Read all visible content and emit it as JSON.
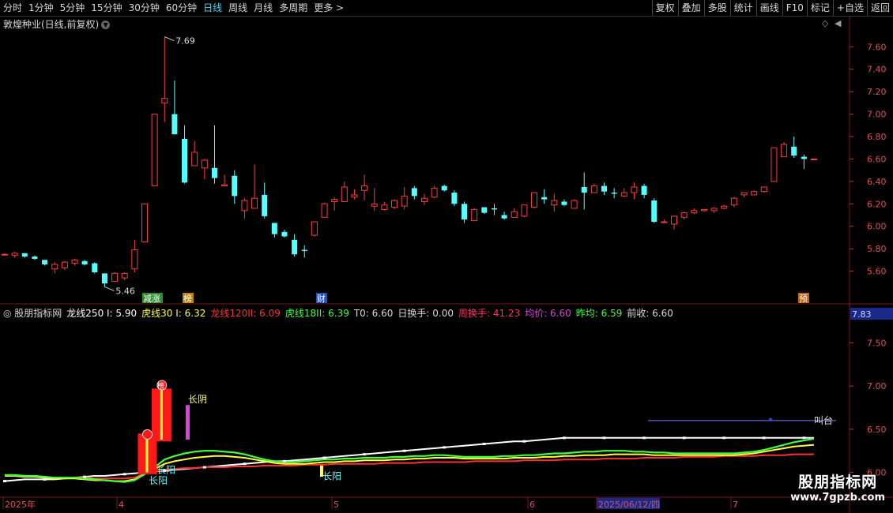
{
  "toolbar": {
    "periods": [
      "分时",
      "1分钟",
      "5分钟",
      "15分钟",
      "30分钟",
      "60分钟",
      "日线",
      "周线",
      "月线",
      "多周期",
      "更多 >"
    ],
    "active_period": "日线",
    "actions": [
      "复权",
      "叠加",
      "多股",
      "统计",
      "画线",
      "F10",
      "标记",
      "+自选",
      "返回"
    ]
  },
  "main_chart": {
    "title": "敦煌种业(日线,前复权)",
    "price_axis": [
      "7.60",
      "7.40",
      "7.20",
      "7.00",
      "6.80",
      "6.60",
      "6.40",
      "6.20",
      "6.00",
      "5.80",
      "5.60"
    ],
    "high_label": "7.69",
    "low_label": "5.46",
    "markers": [
      "减涨",
      "榜",
      "财",
      "预"
    ]
  },
  "indicator": {
    "name": "股朋指标网",
    "fields": [
      {
        "label": "龙线250 I",
        "value": "5.90",
        "color": "#ffffff"
      },
      {
        "label": "虎线30 I",
        "value": "6.32",
        "color": "#ffff40"
      },
      {
        "label": "龙线120II",
        "value": "6.09",
        "color": "#ff3030"
      },
      {
        "label": "虎线18II",
        "value": "6.39",
        "color": "#40ff40"
      },
      {
        "label": "T0",
        "value": "6.60",
        "color": "#d8d8d8"
      },
      {
        "label": "日换手",
        "value": "0.00",
        "color": "#d8d8d8"
      },
      {
        "label": "周换手",
        "value": "41.23",
        "color": "#ff3060"
      },
      {
        "label": "均价",
        "value": "6.60",
        "color": "#e040e0"
      },
      {
        "label": "昨均",
        "value": "6.59",
        "color": "#40ff40"
      },
      {
        "label": "前收",
        "value": "6.60",
        "color": "#d8d8d8"
      }
    ],
    "axis": [
      "7.50",
      "7.00",
      "6.50",
      "6.00"
    ],
    "axis_top": "7.83",
    "labels": [
      "榜",
      "长阴",
      "长阳",
      "长阳",
      "长阳",
      "叫台"
    ],
    "long_yin_label": "长阴",
    "long_yang_label": "长阳",
    "bang_label": "榜",
    "right_label": "叫台"
  },
  "date_axis": [
    "2025年",
    "4",
    "5",
    "6",
    "2025/06/12/四",
    "7"
  ],
  "watermark": {
    "line1": "股朋指标网",
    "line2": "www.7gpzb.com"
  },
  "chart_data": {
    "type": "candlestick",
    "title": "敦煌种业(日线,前复权)",
    "ylim": [
      5.4,
      7.75
    ],
    "candles": [
      [
        5.75,
        5.76,
        5.74,
        5.75
      ],
      [
        5.74,
        5.77,
        5.72,
        5.76
      ],
      [
        5.76,
        5.76,
        5.72,
        5.73
      ],
      [
        5.73,
        5.74,
        5.7,
        5.71
      ],
      [
        5.7,
        5.7,
        5.65,
        5.66
      ],
      [
        5.62,
        5.68,
        5.58,
        5.66
      ],
      [
        5.63,
        5.69,
        5.61,
        5.68
      ],
      [
        5.67,
        5.71,
        5.65,
        5.7
      ],
      [
        5.69,
        5.7,
        5.65,
        5.66
      ],
      [
        5.67,
        5.68,
        5.58,
        5.59
      ],
      [
        5.58,
        5.58,
        5.46,
        5.49
      ],
      [
        5.51,
        5.59,
        5.51,
        5.58
      ],
      [
        5.54,
        5.59,
        5.52,
        5.58
      ],
      [
        5.62,
        5.88,
        5.59,
        5.79
      ],
      [
        5.86,
        6.11,
        5.86,
        6.2
      ],
      [
        6.36,
        7.0,
        6.36,
        7.0
      ],
      [
        7.1,
        7.69,
        6.93,
        7.14
      ],
      [
        7.0,
        7.3,
        6.83,
        6.82
      ],
      [
        6.78,
        6.9,
        6.38,
        6.39
      ],
      [
        6.54,
        6.76,
        6.54,
        6.66
      ],
      [
        6.52,
        6.6,
        6.42,
        6.59
      ],
      [
        6.52,
        6.9,
        6.38,
        6.43
      ],
      [
        6.36,
        6.46,
        6.36,
        6.37
      ],
      [
        6.45,
        6.5,
        6.2,
        6.27
      ],
      [
        6.14,
        6.25,
        6.07,
        6.23
      ],
      [
        6.16,
        6.55,
        6.16,
        6.25
      ],
      [
        6.28,
        6.39,
        6.07,
        6.09
      ],
      [
        6.03,
        6.03,
        5.9,
        5.93
      ],
      [
        5.95,
        5.97,
        5.9,
        5.91
      ],
      [
        5.88,
        5.93,
        5.73,
        5.75
      ],
      [
        5.79,
        5.83,
        5.72,
        5.78
      ],
      [
        5.92,
        6.04,
        5.91,
        6.04
      ],
      [
        6.08,
        6.21,
        6.08,
        6.2
      ],
      [
        6.22,
        6.26,
        6.14,
        6.24
      ],
      [
        6.22,
        6.4,
        6.22,
        6.35
      ],
      [
        6.26,
        6.33,
        6.24,
        6.28
      ],
      [
        6.32,
        6.46,
        6.23,
        6.36
      ],
      [
        6.18,
        6.34,
        6.14,
        6.2
      ],
      [
        6.15,
        6.22,
        6.14,
        6.19
      ],
      [
        6.17,
        6.24,
        6.15,
        6.23
      ],
      [
        6.18,
        6.35,
        6.15,
        6.27
      ],
      [
        6.34,
        6.36,
        6.24,
        6.27
      ],
      [
        6.22,
        6.29,
        6.19,
        6.25
      ],
      [
        6.26,
        6.36,
        6.25,
        6.34
      ],
      [
        6.36,
        6.37,
        6.31,
        6.32
      ],
      [
        6.3,
        6.32,
        6.18,
        6.2
      ],
      [
        6.2,
        6.22,
        6.03,
        6.06
      ],
      [
        6.05,
        6.16,
        6.05,
        6.15
      ],
      [
        6.17,
        6.17,
        6.11,
        6.12
      ],
      [
        6.16,
        6.2,
        6.1,
        6.15
      ],
      [
        6.1,
        6.13,
        6.06,
        6.07
      ],
      [
        6.08,
        6.16,
        6.08,
        6.13
      ],
      [
        6.09,
        6.19,
        6.08,
        6.19
      ],
      [
        6.17,
        6.25,
        6.16,
        6.3
      ],
      [
        6.26,
        6.33,
        6.2,
        6.24
      ],
      [
        6.19,
        6.29,
        6.13,
        6.23
      ],
      [
        6.22,
        6.24,
        6.18,
        6.19
      ],
      [
        6.16,
        6.24,
        6.16,
        6.23
      ],
      [
        6.35,
        6.48,
        6.15,
        6.3
      ],
      [
        6.3,
        6.38,
        6.3,
        6.36
      ],
      [
        6.36,
        6.39,
        6.28,
        6.31
      ],
      [
        6.3,
        6.34,
        6.25,
        6.29
      ],
      [
        6.27,
        6.34,
        6.26,
        6.3
      ],
      [
        6.3,
        6.39,
        6.24,
        6.35
      ],
      [
        6.36,
        6.38,
        6.25,
        6.28
      ],
      [
        6.23,
        6.25,
        6.03,
        6.04
      ],
      [
        6.04,
        6.06,
        6.03,
        6.04
      ],
      [
        6.02,
        6.07,
        5.97,
        6.09
      ],
      [
        6.08,
        6.13,
        6.06,
        6.12
      ],
      [
        6.12,
        6.16,
        6.11,
        6.14
      ],
      [
        6.14,
        6.15,
        6.13,
        6.15
      ],
      [
        6.14,
        6.17,
        6.12,
        6.16
      ],
      [
        6.16,
        6.19,
        6.15,
        6.18
      ],
      [
        6.19,
        6.26,
        6.17,
        6.25
      ],
      [
        6.28,
        6.3,
        6.26,
        6.3
      ],
      [
        6.28,
        6.32,
        6.28,
        6.31
      ],
      [
        6.31,
        6.35,
        6.3,
        6.35
      ],
      [
        6.4,
        6.67,
        6.4,
        6.7
      ],
      [
        6.62,
        6.75,
        6.62,
        6.73
      ],
      [
        6.71,
        6.8,
        6.61,
        6.63
      ],
      [
        6.62,
        6.64,
        6.51,
        6.6
      ],
      [
        6.6,
        6.6,
        6.6,
        6.6
      ]
    ],
    "indicator_series": [
      {
        "name": "龙线250 I",
        "color": "#ffffff",
        "values": [
          5.9,
          5.91,
          5.92,
          5.92,
          5.92,
          5.92,
          5.93,
          5.94,
          5.95,
          5.96,
          5.96,
          5.97,
          5.98,
          5.99,
          6.0,
          6.01,
          6.02,
          6.03,
          6.04,
          6.05,
          6.06,
          6.07,
          6.08,
          6.09,
          6.1,
          6.11,
          6.12,
          6.13,
          6.13,
          6.14,
          6.15,
          6.16,
          6.17,
          6.18,
          6.19,
          6.2,
          6.21,
          6.22,
          6.23,
          6.24,
          6.25,
          6.26,
          6.27,
          6.28,
          6.29,
          6.3,
          6.31,
          6.32,
          6.33,
          6.34,
          6.35,
          6.36,
          6.36,
          6.37,
          6.38,
          6.39,
          6.4,
          6.4,
          6.4,
          6.4,
          6.4,
          6.4,
          6.4,
          6.4,
          6.4,
          6.4,
          6.4,
          6.4,
          6.4,
          6.4,
          6.4,
          6.4,
          6.4,
          6.4,
          6.4,
          6.4,
          6.4,
          6.4,
          6.4,
          6.4,
          6.4,
          6.4
        ]
      },
      {
        "name": "龙线120II",
        "color": "#ff3030",
        "values": [
          5.96,
          5.96,
          5.96,
          5.96,
          5.95,
          5.94,
          5.94,
          5.94,
          5.94,
          5.93,
          5.93,
          5.93,
          5.93,
          5.94,
          5.99,
          6.01,
          6.03,
          6.04,
          6.05,
          6.05,
          6.06,
          6.06,
          6.06,
          6.07,
          6.07,
          6.07,
          6.08,
          6.08,
          6.08,
          6.08,
          6.09,
          6.09,
          6.09,
          6.1,
          6.1,
          6.1,
          6.1,
          6.1,
          6.11,
          6.11,
          6.11,
          6.11,
          6.12,
          6.12,
          6.12,
          6.12,
          6.12,
          6.13,
          6.13,
          6.13,
          6.13,
          6.13,
          6.14,
          6.14,
          6.14,
          6.14,
          6.15,
          6.15,
          6.15,
          6.15,
          6.16,
          6.16,
          6.16,
          6.16,
          6.17,
          6.17,
          6.17,
          6.17,
          6.18,
          6.18,
          6.18,
          6.18,
          6.19,
          6.19,
          6.19,
          6.19,
          6.2,
          6.2,
          6.2,
          6.21,
          6.21,
          6.21
        ]
      },
      {
        "name": "虎线30 I",
        "color": "#ffff40",
        "values": [
          5.96,
          5.96,
          5.95,
          5.95,
          5.94,
          5.93,
          5.93,
          5.93,
          5.92,
          5.91,
          5.91,
          5.9,
          5.9,
          5.92,
          5.98,
          6.04,
          6.1,
          6.13,
          6.15,
          6.17,
          6.18,
          6.19,
          6.19,
          6.18,
          6.17,
          6.15,
          6.13,
          6.11,
          6.1,
          6.1,
          6.1,
          6.11,
          6.12,
          6.12,
          6.13,
          6.13,
          6.14,
          6.14,
          6.14,
          6.15,
          6.15,
          6.16,
          6.16,
          6.17,
          6.17,
          6.17,
          6.16,
          6.16,
          6.16,
          6.16,
          6.16,
          6.17,
          6.17,
          6.17,
          6.18,
          6.18,
          6.19,
          6.19,
          6.2,
          6.2,
          6.2,
          6.21,
          6.21,
          6.21,
          6.21,
          6.2,
          6.2,
          6.2,
          6.2,
          6.2,
          6.2,
          6.2,
          6.2,
          6.2,
          6.21,
          6.22,
          6.24,
          6.26,
          6.28,
          6.3,
          6.31,
          6.32
        ]
      },
      {
        "name": "虎线18II",
        "color": "#40ff40",
        "values": [
          5.97,
          5.97,
          5.96,
          5.96,
          5.95,
          5.94,
          5.94,
          5.94,
          5.93,
          5.92,
          5.91,
          5.9,
          5.89,
          5.91,
          5.98,
          6.06,
          6.15,
          6.19,
          6.22,
          6.24,
          6.25,
          6.25,
          6.24,
          6.23,
          6.21,
          6.18,
          6.15,
          6.13,
          6.12,
          6.12,
          6.13,
          6.14,
          6.15,
          6.15,
          6.16,
          6.16,
          6.17,
          6.17,
          6.17,
          6.18,
          6.18,
          6.19,
          6.19,
          6.2,
          6.2,
          6.19,
          6.18,
          6.18,
          6.18,
          6.18,
          6.19,
          6.19,
          6.2,
          6.2,
          6.21,
          6.22,
          6.22,
          6.23,
          6.24,
          6.24,
          6.25,
          6.25,
          6.25,
          6.24,
          6.24,
          6.23,
          6.23,
          6.22,
          6.22,
          6.22,
          6.22,
          6.22,
          6.22,
          6.22,
          6.23,
          6.24,
          6.26,
          6.29,
          6.32,
          6.35,
          6.37,
          6.39
        ]
      }
    ]
  }
}
